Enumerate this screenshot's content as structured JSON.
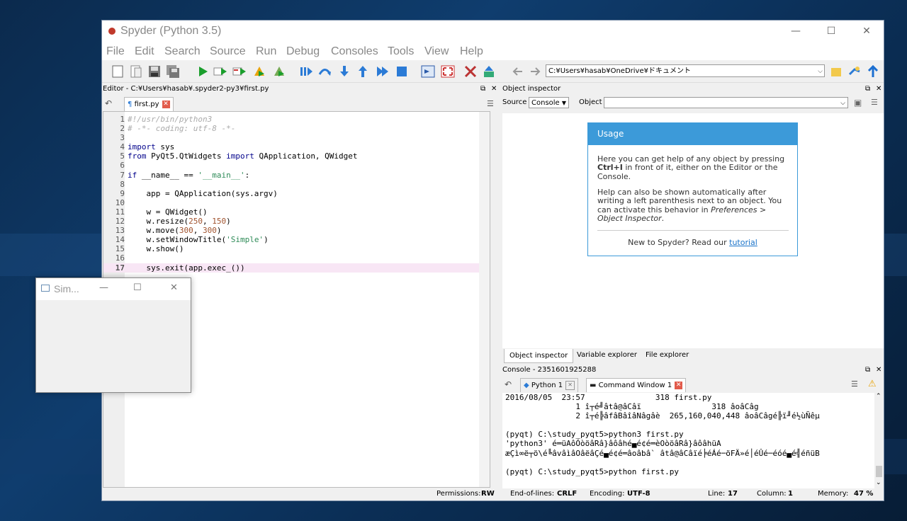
{
  "app": {
    "title": "Spyder (Python 3.5)",
    "min_glyph": "—",
    "max_glyph": "☐",
    "close_glyph": "✕"
  },
  "menu": [
    "File",
    "Edit",
    "Search",
    "Source",
    "Run",
    "Debug",
    "Consoles",
    "Tools",
    "View",
    "Help"
  ],
  "toolbar": {
    "path": "C:¥Users¥hasab¥OneDrive¥ドキュメント"
  },
  "editor": {
    "pane_title": "Editor - C:¥Users¥hasab¥.spyder2-py3¥first.py",
    "tab_label": "first.py",
    "current_line": 17,
    "lines": [
      "#!/usr/bin/python3",
      "# -*- coding: utf-8 -*-",
      "",
      "import sys",
      "from PyQt5.QtWidgets import QApplication, QWidget",
      "",
      "if __name__ == '__main__':",
      "",
      "    app = QApplication(sys.argv)",
      "",
      "    w = QWidget()",
      "    w.resize(250, 150)",
      "    w.move(300, 300)",
      "    w.setWindowTitle('Simple')",
      "    w.show()",
      "",
      "    sys.exit(app.exec_())"
    ]
  },
  "inspector": {
    "pane_title": "Object inspector",
    "source_label": "Source",
    "source_value": "Console",
    "object_label": "Object",
    "usage": {
      "heading": "Usage",
      "p1_a": "Here you can get help of any object by pressing",
      "p1_bold": "Ctrl+I",
      "p1_b": "in front of it, either on the Editor or the Console.",
      "p2_a": "Help can also be shown automatically after writing a left parenthesis next to an object. You can activate this behavior in",
      "p2_em": "Preferences > Object Inspector",
      "p2_b": ".",
      "new_text": "New to Spyder? Read our",
      "link": "tutorial"
    },
    "bottom_tabs": [
      "Object inspector",
      "Variable explorer",
      "File explorer"
    ]
  },
  "console": {
    "pane_title": "Console - 2351601925288",
    "tabs": [
      "Python 1",
      "Command Window 1"
    ],
    "lines": [
      "2016/08/05  23:57               318 first.py",
      "               1 î┬é╝âtâ@âCâï               318 âoâCâg",
      "               2 î┬é╠âfâBâîâNâgâè  265,160,040,448 âoâCâgé╠ï╜é½ùÑêµ",
      "",
      "(pyqt) C:\\study_pyqt5>python3 first.py",
      "'python3' é═üAôÓòöâRâ}âôâhé▄é¢é═èOòöâRâ}âôâhüA",
      "æÇì∞ë┬ö\\é╚âvâìâOâëâÇé▄é¢é═âoâbâ` âtâ@âCâïé╞éÁé─öFÄ»é│éÛé─éóé▄é╣éñüB",
      "",
      "(pyqt) C:\\study_pyqt5>python first.py"
    ]
  },
  "status": {
    "permissions_label": "Permissions:",
    "permissions": "RW",
    "eol_label": "End-of-lines:",
    "eol": "CRLF",
    "encoding_label": "Encoding:",
    "encoding": "UTF-8",
    "line_label": "Line:",
    "line": "17",
    "column_label": "Column:",
    "column": "1",
    "memory_label": "Memory:",
    "memory": "47 %"
  },
  "simple_window": {
    "title": "Sim..."
  },
  "colors": {
    "accent": "#3c9ad9",
    "keyword": "#00008b",
    "string": "#2e8b57",
    "number": "#a0522d",
    "current_line": "#f8e6f5"
  }
}
